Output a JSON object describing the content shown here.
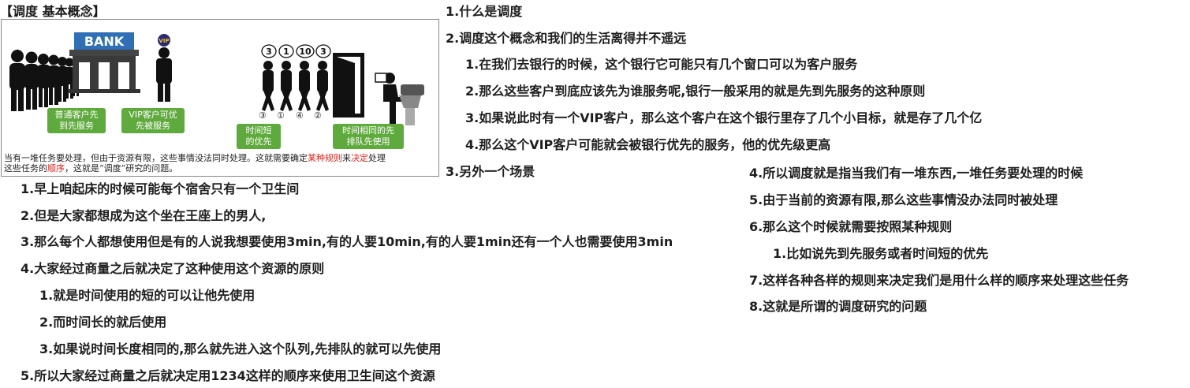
{
  "title": "【调度 基本概念】",
  "figure": {
    "bank_label": "BANK",
    "vip_badge": "VIP",
    "box_normal": [
      "普通客户先",
      "到先服务"
    ],
    "box_vip": [
      "VIP客户可优",
      "先被服务"
    ],
    "box_short": [
      "时间短",
      "的优先"
    ],
    "box_same": [
      "时间相同的先",
      "排队先使用"
    ],
    "bubbles": [
      "3",
      "1",
      "10",
      "3"
    ],
    "order_marks": [
      "③",
      "①",
      "④",
      "②"
    ],
    "caption_parts": {
      "p1": "当有一堆任务要处理，但由于资源有限，这些事情没法同时处理。这就需要确定",
      "red1": "某种规则",
      "p2": "来",
      "red2": "决定",
      "p3": "处理",
      "p4": "这些任务的",
      "red3": "顺序",
      "p5": "，这就是“调度”研究的问题。"
    }
  },
  "top_notes": [
    "1.什么是调度",
    "2.调度这个概念和我们的生活离得并不遥远",
    "1.在我们去银行的时候，这个银行它可能只有几个窗口可以为客户服务",
    "2.那么这些客户到底应该先为谁服务呢,银行一般采用的就是先到先服务的这种原则",
    "3.如果说此时有一个VIP客户，那么这个客户在这个银行里存了几个小目标，就是存了几个亿",
    "4.那么这个VIP客户可能就会被银行优先的服务，他的优先级更高",
    "3.另外一个场景"
  ],
  "right_notes": [
    "4.所以调度就是指当我们有一堆东西,一堆任务要处理的时候",
    "5.由于当前的资源有限,那么这些事情没办法同时被处理",
    "6.那么这个时候就需要按照某种规则",
    "1.比如说先到先服务或者时间短的优先",
    "7.这样各种各样的规则来决定我们是用什么样的顺序来处理这些任务",
    "8.这就是所谓的调度研究的问题"
  ],
  "left_notes": [
    "1.早上咱起床的时候可能每个宿舍只有一个卫生间",
    "2.但是大家都想成为这个坐在王座上的男人,",
    "3.那么每个人都想使用但是有的人说我想要使用3min,有的人要10min,有的人要1min还有一个人也需要使用3min",
    "4.大家经过商量之后就决定了这种使用这个资源的原则",
    "1.就是时间使用的短的可以让他先使用",
    "2.而时间长的就后使用",
    "3.如果说时间长度相同的,那么就先进入这个队列,先排队的就可以先使用",
    "5.所以大家经过商量之后就决定用1234这样的顺序来使用卫生间这个资源"
  ]
}
